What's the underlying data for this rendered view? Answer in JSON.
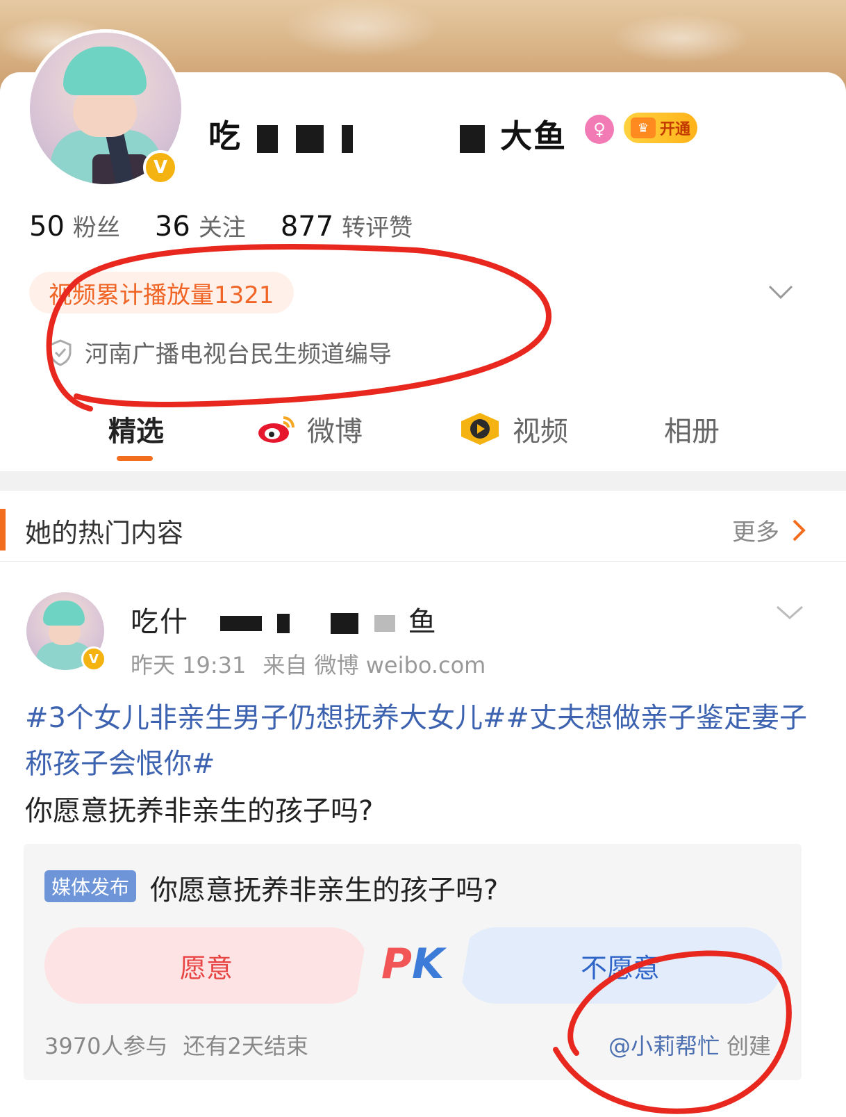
{
  "profile": {
    "name_prefix": "吃",
    "name_suffix": "大鱼",
    "verified_badge": "V",
    "gender_icon": "female-icon",
    "vip_label": "开通",
    "stats": [
      {
        "value": "50",
        "label": "粉丝"
      },
      {
        "value": "36",
        "label": "关注"
      },
      {
        "value": "877",
        "label": "转评赞"
      }
    ],
    "play_count_tag": "视频累计播放量1321",
    "certification": "河南广播电视台民生频道编导"
  },
  "tabs": [
    {
      "label": "精选",
      "active": true
    },
    {
      "label": "微博",
      "icon": "weibo-icon"
    },
    {
      "label": "视频",
      "icon": "video-play-icon"
    },
    {
      "label": "相册"
    }
  ],
  "hot_section": {
    "title": "她的热门内容",
    "more_label": "更多"
  },
  "post": {
    "author_prefix": "吃什",
    "author_suffix": "鱼",
    "time": "昨天 19:31",
    "source": "来自 微博 weibo.com",
    "topics": "#3个女儿非亲生男子仍想抚养大女儿##丈夫想做亲子鉴定妻子称孩子会恨你#",
    "body": "你愿意抚养非亲生的孩子吗?"
  },
  "vote": {
    "tag": "媒体发布",
    "question": "你愿意抚养非亲生的孩子吗?",
    "option_yes": "愿意",
    "option_no": "不愿意",
    "pk_p": "P",
    "pk_k": "K",
    "participants": "3970人参与",
    "remaining": "还有2天结束",
    "creator": "@小莉帮忙",
    "creator_suffix": "创建"
  },
  "colors": {
    "accent_orange": "#f36d1e",
    "link_blue": "#3c62b0",
    "annotation_red": "#e8281e"
  }
}
